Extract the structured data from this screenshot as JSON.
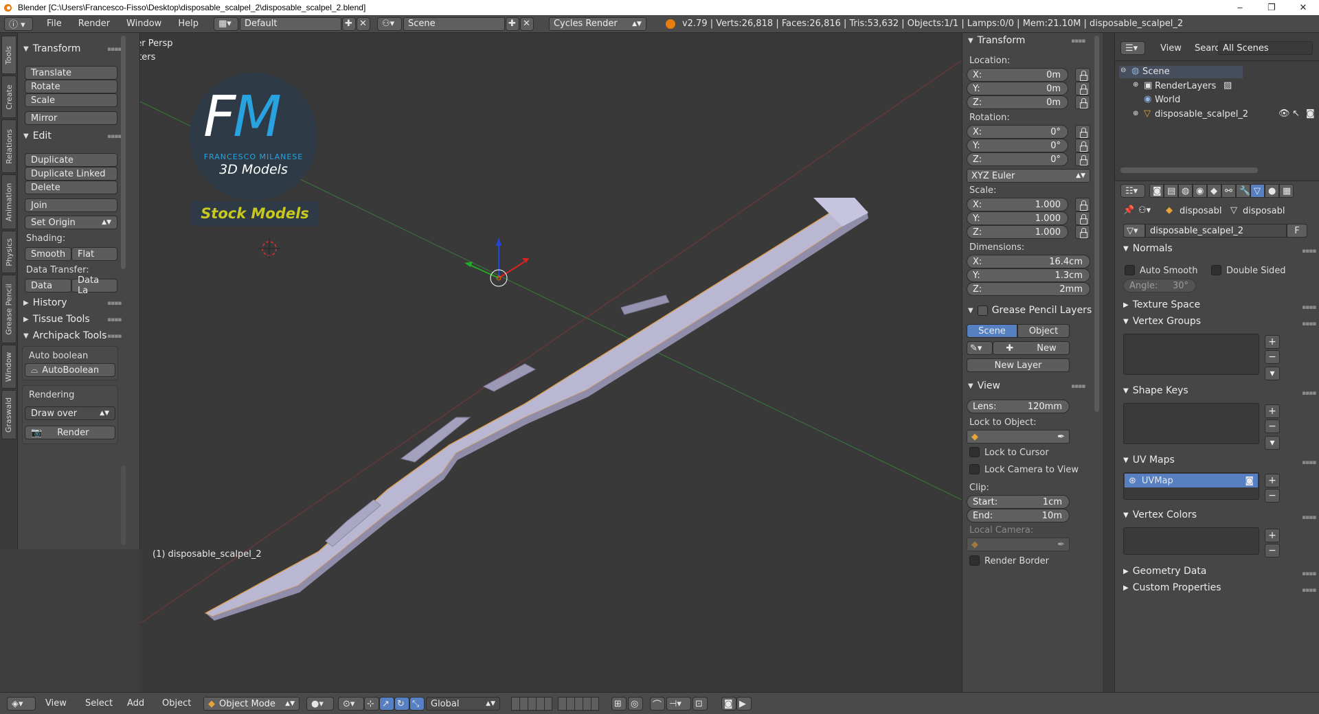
{
  "window": {
    "title": "Blender [C:\\Users\\Francesco-Fisso\\Desktop\\disposable_scalpel_2\\disposable_scalpel_2.blend]",
    "controls": [
      "–",
      "❐",
      "✕"
    ]
  },
  "info_header": {
    "menus": [
      "File",
      "Render",
      "Window",
      "Help"
    ],
    "screen_layout": "Default",
    "scene": "Scene",
    "render_engine": "Cycles Render",
    "stats": "v2.79 | Verts:26,818 | Faces:26,816 | Tris:53,632 | Objects:1/1 | Lamps:0/0 | Mem:21.10M | disposable_scalpel_2"
  },
  "tool_tabs": [
    "Tools",
    "Create",
    "Relations",
    "Animation",
    "Physics",
    "Grease Pencil",
    "Window",
    "Graswald"
  ],
  "tool_shelf": {
    "transform": {
      "title": "Transform",
      "buttons": [
        "Translate",
        "Rotate",
        "Scale",
        "Mirror"
      ]
    },
    "edit": {
      "title": "Edit",
      "buttons": [
        "Duplicate",
        "Duplicate Linked",
        "Delete",
        "Join"
      ],
      "set_origin": "Set Origin"
    },
    "shading": {
      "label": "Shading:",
      "smooth": "Smooth",
      "flat": "Flat"
    },
    "data_transfer": {
      "label": "Data Transfer:",
      "data": "Data",
      "data_layout": "Data La"
    },
    "history": "History",
    "tissue": "Tissue Tools",
    "archipack": "Archipack Tools",
    "autoboolean": {
      "label": "Auto boolean",
      "button": "AutoBoolean"
    },
    "rendering": {
      "label": "Rendering",
      "draw_mode": "Draw over",
      "render": "Render"
    }
  },
  "viewport": {
    "view_name": "User Persp",
    "units": "Meters",
    "object_label": "(1) disposable_scalpel_2",
    "watermark": {
      "initials": "FM",
      "name": "FRANCESCO MILANESE",
      "subtitle": "3D Models",
      "banner": "Stock Models"
    }
  },
  "n_panel": {
    "transform_title": "Transform",
    "location_label": "Location:",
    "location": [
      {
        "axis": "X:",
        "value": "0m"
      },
      {
        "axis": "Y:",
        "value": "0m"
      },
      {
        "axis": "Z:",
        "value": "0m"
      }
    ],
    "rotation_label": "Rotation:",
    "rotation": [
      {
        "axis": "X:",
        "value": "0°"
      },
      {
        "axis": "Y:",
        "value": "0°"
      },
      {
        "axis": "Z:",
        "value": "0°"
      }
    ],
    "rotation_mode": "XYZ Euler",
    "scale_label": "Scale:",
    "scale": [
      {
        "axis": "X:",
        "value": "1.000"
      },
      {
        "axis": "Y:",
        "value": "1.000"
      },
      {
        "axis": "Z:",
        "value": "1.000"
      }
    ],
    "dimensions_label": "Dimensions:",
    "dimensions": [
      {
        "axis": "X:",
        "value": "16.4cm"
      },
      {
        "axis": "Y:",
        "value": "1.3cm"
      },
      {
        "axis": "Z:",
        "value": "2mm"
      }
    ],
    "grease_pencil_title": "Grease Pencil Layers",
    "gp_scene": "Scene",
    "gp_object": "Object",
    "gp_new": "New",
    "gp_new_layer": "New Layer",
    "view_title": "View",
    "lens_label": "Lens:",
    "lens": "120mm",
    "lock_to_object": "Lock to Object:",
    "lock_to_cursor": "Lock to Cursor",
    "lock_camera": "Lock Camera to View",
    "clip_label": "Clip:",
    "clip_start_label": "Start:",
    "clip_start": "1cm",
    "clip_end_label": "End:",
    "clip_end": "10m",
    "local_camera": "Local Camera:",
    "render_border": "Render Border"
  },
  "outliner": {
    "menus": [
      "View",
      "Search"
    ],
    "filter": "All Scenes",
    "items": [
      "Scene",
      "RenderLayers",
      "World",
      "disposable_scalpel_2"
    ]
  },
  "properties": {
    "breadcrumb_1": "disposabl",
    "breadcrumb_2": "disposabl",
    "mesh_name": "disposable_scalpel_2",
    "fake_user": "F",
    "normals_title": "Normals",
    "auto_smooth": "Auto Smooth",
    "double_sided": "Double Sided",
    "angle_label": "Angle:",
    "angle_value": "30°",
    "texture_space": "Texture Space",
    "vertex_groups": "Vertex Groups",
    "shape_keys": "Shape Keys",
    "uv_maps": "UV Maps",
    "uv_map_item": "UVMap",
    "vertex_colors": "Vertex Colors",
    "geometry_data": "Geometry Data",
    "custom_properties": "Custom Properties"
  },
  "footer": {
    "menus": [
      "View",
      "Select",
      "Add",
      "Object"
    ],
    "mode": "Object Mode",
    "orientation": "Global"
  },
  "colors": {
    "accent_blue": "#5680c2",
    "watermark_blue": "#29a3e0",
    "banner_yellow": "#c8c81e",
    "object_mesh": "#b9b7d2"
  }
}
